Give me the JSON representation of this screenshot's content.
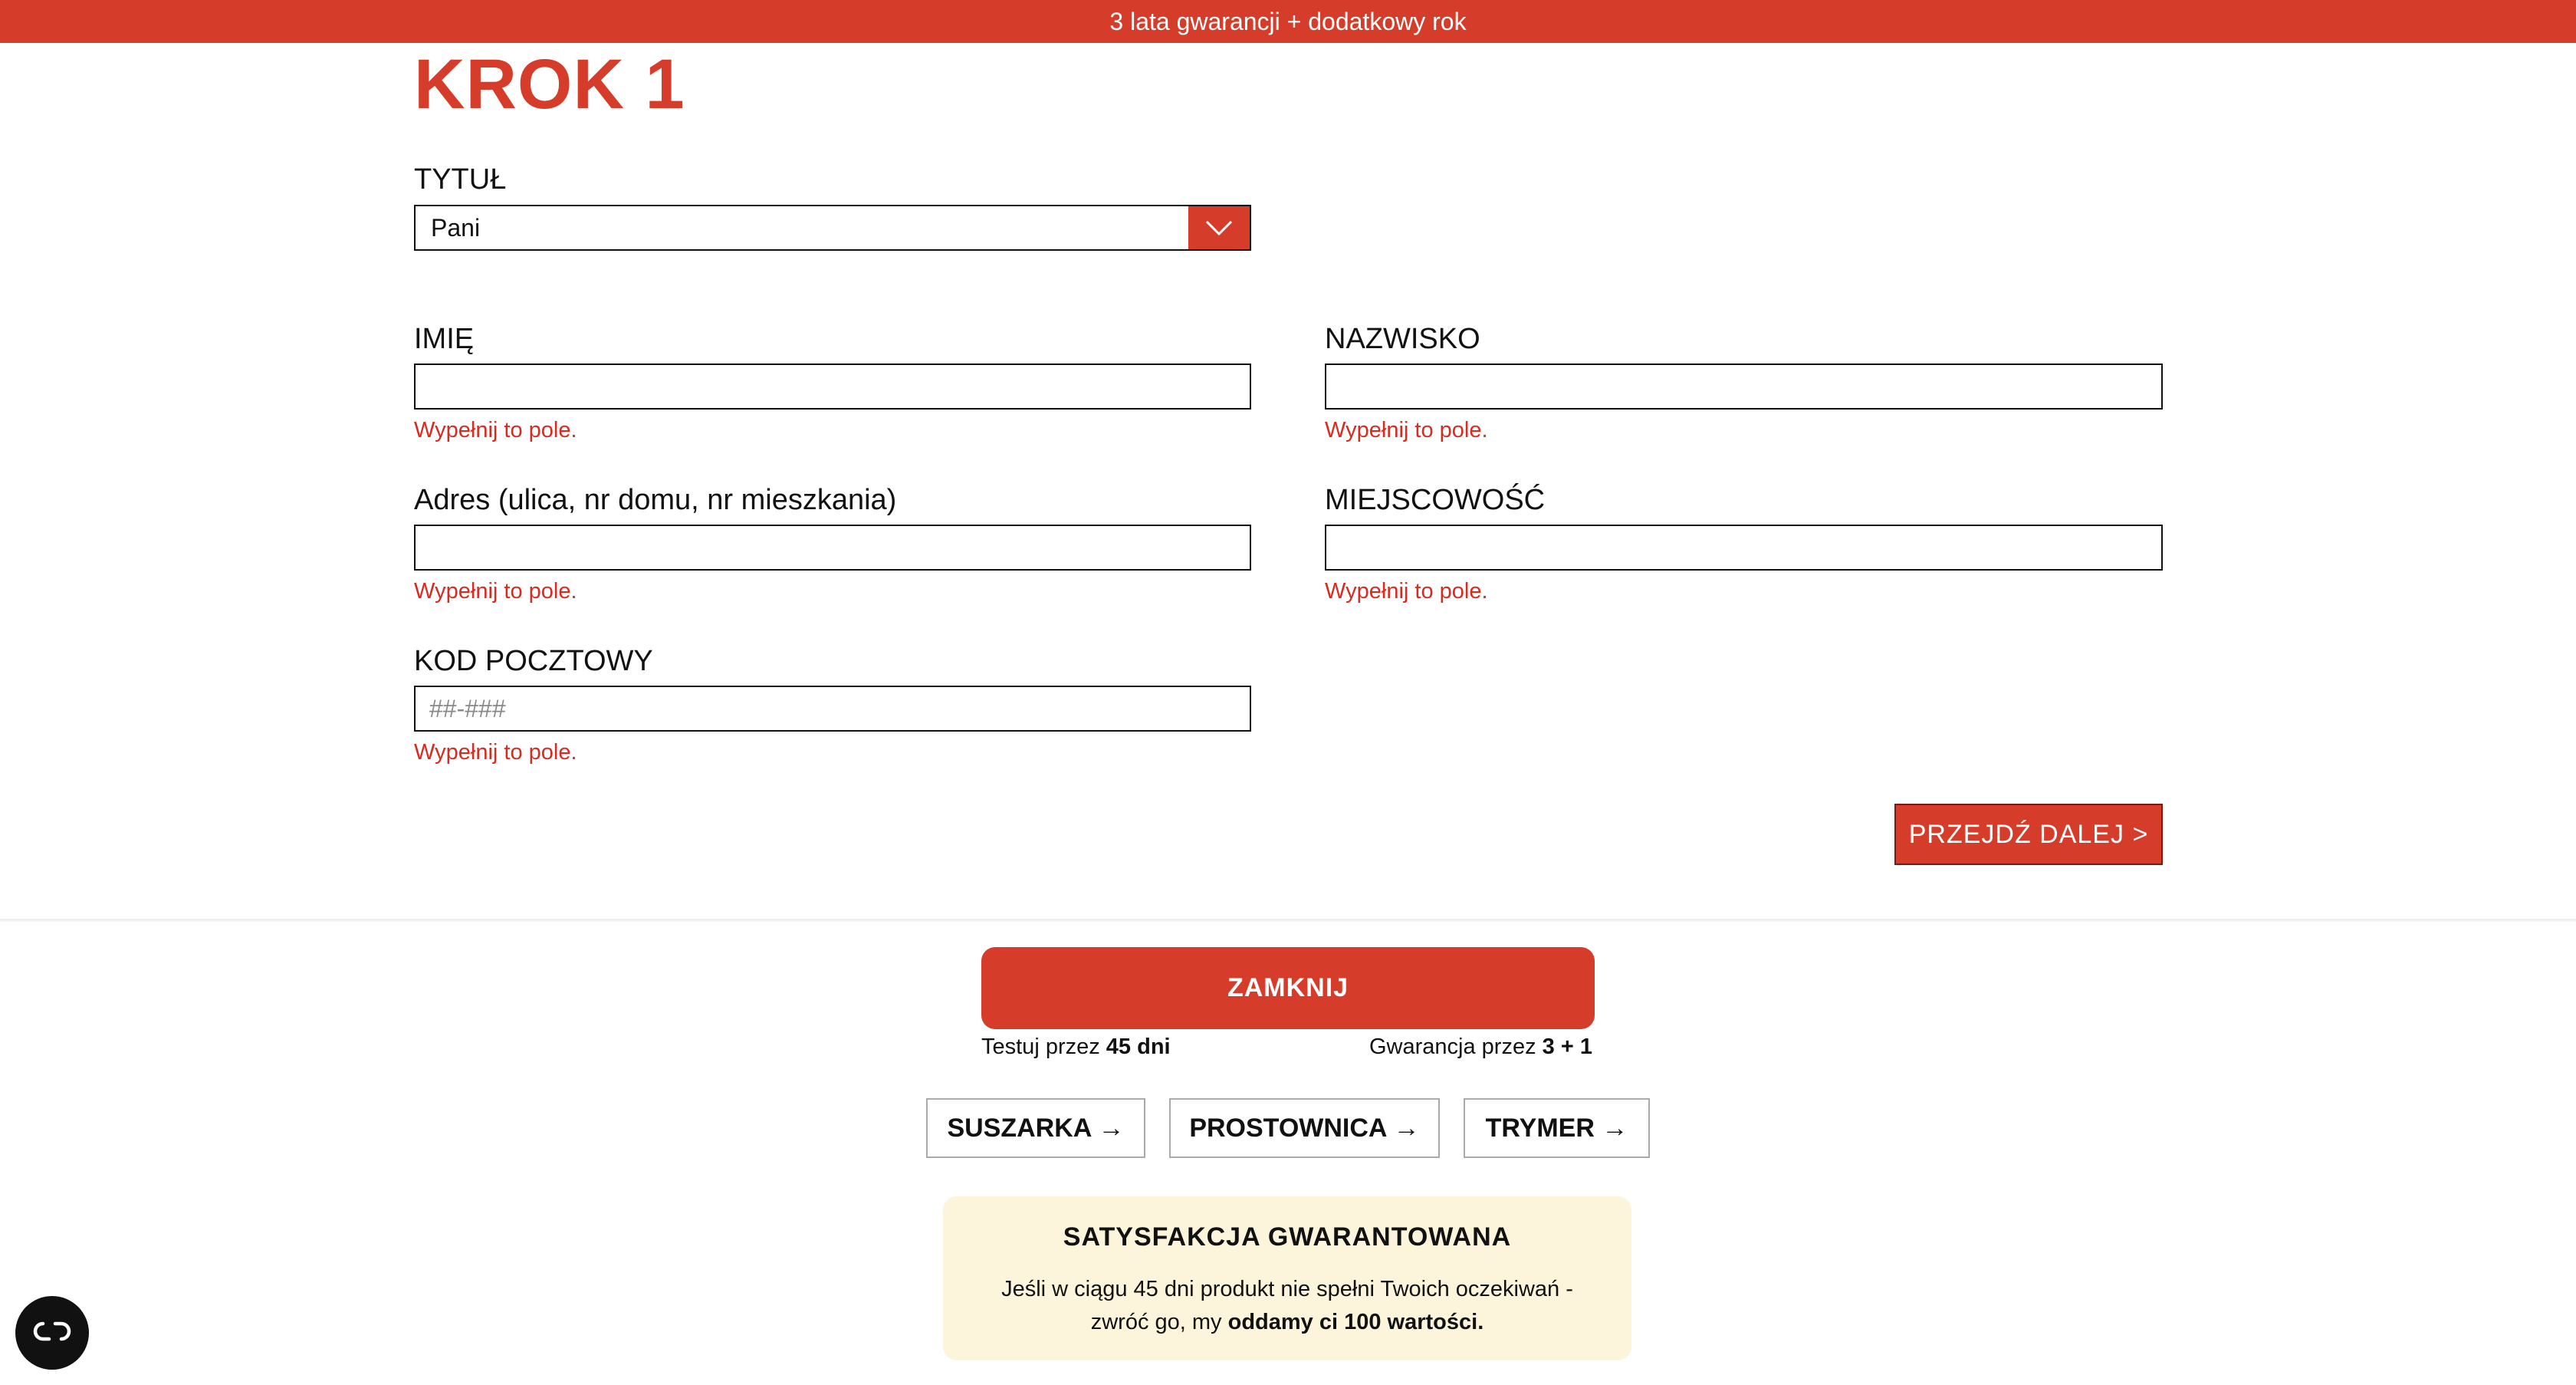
{
  "banner": {
    "text": "3 lata gwarancji + dodatkowy rok"
  },
  "step": {
    "title": "KROK 1"
  },
  "form": {
    "title_label": "TYTUŁ",
    "title_value": "Pani",
    "first_name_label": "IMIĘ",
    "last_name_label": "NAZWISKO",
    "address_label": "Adres (ulica, nr domu, nr mieszkania)",
    "city_label": "MIEJSCOWOŚĆ",
    "postal_label": "KOD POCZTOWY",
    "postal_placeholder": "##-###",
    "error_text": "Wypełnij to pole.",
    "next_label": "PRZEJDŹ DALEJ >"
  },
  "footer": {
    "close_label": "ZAMKNIJ",
    "test_prefix": "Testuj przez ",
    "test_value": "45 dni",
    "warranty_prefix": "Gwarancja przez ",
    "warranty_value": "3 + 1",
    "categories": [
      "SUSZARKA →",
      "PROSTOWNICA →",
      "TRYMER →"
    ],
    "guarantee_title": "SATYSFAKCJA GWARANTOWANA",
    "guarantee_line1": "Jeśli w ciągu 45 dni produkt nie spełni Twoich oczekiwań -",
    "guarantee_line2_prefix": "zwróć go, my ",
    "guarantee_line2_bold": "oddamy ci 100 wartości."
  },
  "colors": {
    "accent": "#d63c2a",
    "error": "#d62b1e",
    "guarantee_bg": "#fcf5dc"
  },
  "icons": {
    "select_arrow": "chevron-down-icon",
    "fab": "accessibility-icon"
  }
}
